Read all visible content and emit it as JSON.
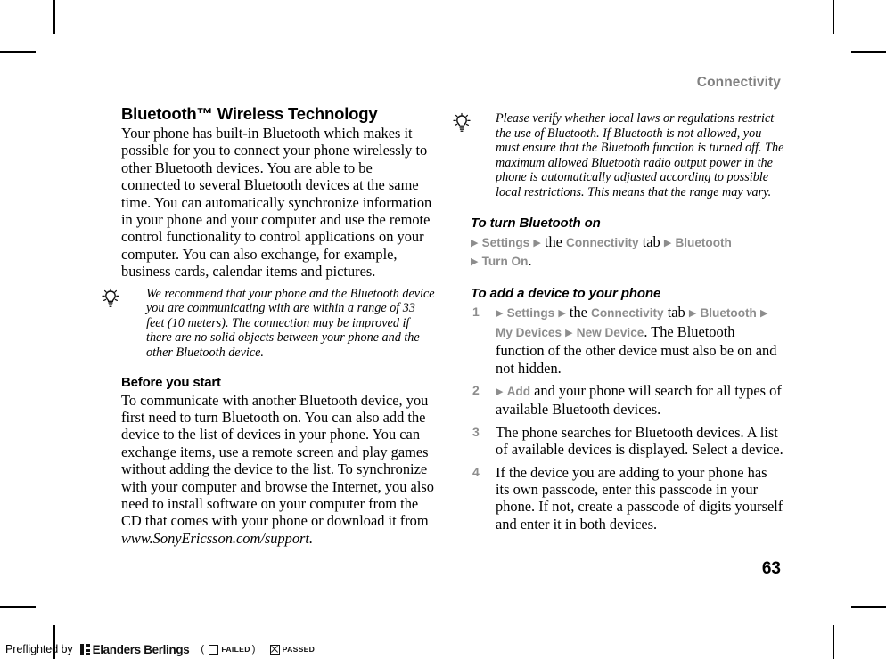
{
  "header": {
    "running_head": "Connectivity",
    "accent_gray": "#808080"
  },
  "folio": {
    "page_number": "63"
  },
  "left_column": {
    "title": "Bluetooth™ Wireless Technology",
    "intro_paragraph": "Your phone has built-in Bluetooth which makes it possible for you to connect your phone wirelessly to other Bluetooth devices. You are able to be connected to several Bluetooth devices at the same time. You can automatically synchronize information in your phone and your computer and use the remote control functionality to control applications on your computer. You can also exchange, for example, business cards, calendar items and pictures.",
    "tip": {
      "icon": "lightbulb-tip-icon",
      "text": "We recommend that your phone and the Bluetooth device you are communicating with are within a range of 33 feet (10 meters). The connection may be improved if there are no solid objects between your phone and the other Bluetooth device."
    },
    "subheading": "Before you start",
    "body_paragraph": "To communicate with another Bluetooth device, you first need to turn Bluetooth on. You can also add the device to the list of devices in your phone. You can exchange items, use a remote screen and play games without adding the device to the list. To synchronize with your computer and browse the Internet, you also need to install software on your computer from the CD that comes with your phone or download it from ",
    "body_paragraph_url": "www.SonyEricsson.com/support."
  },
  "right_column": {
    "tip": {
      "icon": "lightbulb-tip-icon",
      "text": "Please verify whether local laws or regulations restrict the use of Bluetooth. If Bluetooth is not allowed, you must ensure that the Bluetooth function is turned off. The maximum allowed Bluetooth radio output power in the phone is automatically adjusted according to possible local restrictions. This means that the range may vary."
    },
    "task_turn_on": {
      "heading": "To turn Bluetooth on",
      "arrow": "▶",
      "menu_gray": "#8d8d8d",
      "line1": [
        {
          "kind": "arrow"
        },
        {
          "kind": "menu",
          "text": "Settings"
        },
        {
          "kind": "arrow"
        },
        {
          "kind": "plain",
          "text": "the"
        },
        {
          "kind": "menu",
          "text": "Connectivity"
        },
        {
          "kind": "plain",
          "text": "tab"
        },
        {
          "kind": "arrow"
        },
        {
          "kind": "menu",
          "text": "Bluetooth"
        }
      ],
      "line2": [
        {
          "kind": "arrow"
        },
        {
          "kind": "menu",
          "text": "Turn On"
        },
        {
          "kind": "plain",
          "text": "."
        }
      ]
    },
    "task_add_device": {
      "heading": "To add a device to your phone",
      "steps": [
        {
          "number": "1",
          "runs": [
            {
              "kind": "arrow"
            },
            {
              "kind": "menu",
              "text": "Settings"
            },
            {
              "kind": "arrow"
            },
            {
              "kind": "plain",
              "text": "the"
            },
            {
              "kind": "menu",
              "text": "Connectivity"
            },
            {
              "kind": "plain",
              "text": "tab"
            },
            {
              "kind": "arrow"
            },
            {
              "kind": "menu",
              "text": "Bluetooth"
            },
            {
              "kind": "arrow"
            },
            {
              "kind": "menu",
              "text": "My Devices"
            },
            {
              "kind": "arrow"
            },
            {
              "kind": "menu",
              "text": "New Device"
            },
            {
              "kind": "plain",
              "text": ". The Bluetooth function of the other device must also be on and not hidden."
            }
          ]
        },
        {
          "number": "2",
          "runs": [
            {
              "kind": "arrow"
            },
            {
              "kind": "menu",
              "text": "Add"
            },
            {
              "kind": "plain",
              "text": "and your phone will search for all types of available Bluetooth devices."
            }
          ]
        },
        {
          "number": "3",
          "runs": [
            {
              "kind": "plain",
              "text": "The phone searches for Bluetooth devices. A list of available devices is displayed. Select a device."
            }
          ]
        },
        {
          "number": "4",
          "runs": [
            {
              "kind": "plain",
              "text": "If the device you are adding to your phone has its own passcode, enter this passcode in your phone. If not, create a passcode of digits yourself and enter it in both devices."
            }
          ]
        }
      ]
    }
  },
  "preflight_bar": {
    "label": "Preflighted by",
    "company": "Elanders Berlings",
    "open_paren": "(",
    "failed_label": "FAILED",
    "close_paren": ")",
    "passed_label": "PASSED",
    "failed_checked": false,
    "passed_checked": true
  }
}
